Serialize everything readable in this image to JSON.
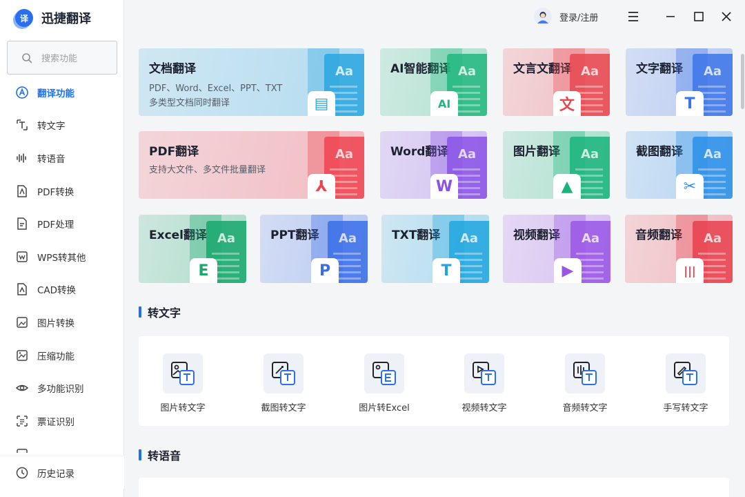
{
  "app": {
    "name": "迅捷翻译",
    "logo_glyph": "译"
  },
  "search": {
    "placeholder": "搜索功能"
  },
  "sidebar": {
    "items": [
      {
        "label": "翻译功能",
        "icon": "translate-icon",
        "active": true
      },
      {
        "label": "转文字",
        "icon": "text-convert-icon"
      },
      {
        "label": "转语音",
        "icon": "voice-icon"
      },
      {
        "label": "PDF转换",
        "icon": "pdf-convert-icon"
      },
      {
        "label": "PDF处理",
        "icon": "pdf-process-icon"
      },
      {
        "label": "WPS转其他",
        "icon": "wps-icon"
      },
      {
        "label": "CAD转换",
        "icon": "cad-icon"
      },
      {
        "label": "图片转换",
        "icon": "image-convert-icon"
      },
      {
        "label": "压缩功能",
        "icon": "compress-icon"
      },
      {
        "label": "多功能识别",
        "icon": "eye-icon"
      },
      {
        "label": "票证识别",
        "icon": "ticket-icon"
      }
    ],
    "history": "历史记录"
  },
  "header": {
    "login": "登录/注册"
  },
  "cards": [
    {
      "title": "文档翻译",
      "desc": [
        "PDF、Word、Excel、PPT、TXT",
        "多类型文档同时翻译"
      ],
      "badge": "▤",
      "color": "#2aa7e0"
    },
    {
      "title": "AI智能翻译",
      "badge": "AI",
      "color": "#21b77f"
    },
    {
      "title": "文言文翻译",
      "badge": "文",
      "color": "#e8474f"
    },
    {
      "title": "文字翻译",
      "badge": "T",
      "color": "#3c74e8"
    },
    {
      "title": "PDF翻译",
      "desc": [
        "支持大文件、多文件批量翻译"
      ],
      "badge": "⅄",
      "color": "#ee4450"
    },
    {
      "title": "Word翻译",
      "badge": "W",
      "color": "#8a52e6"
    },
    {
      "title": "图片翻译",
      "badge": "▲",
      "color": "#19b47b"
    },
    {
      "title": "截图翻译",
      "badge": "✂",
      "color": "#2a8ee8"
    },
    {
      "title": "Excel翻译",
      "badge": "E",
      "color": "#18a86c"
    },
    {
      "title": "PPT翻译",
      "badge": "P",
      "color": "#3a6ee8"
    },
    {
      "title": "TXT翻译",
      "badge": "T",
      "color": "#20a6df"
    },
    {
      "title": "视频翻译",
      "badge": "▶",
      "color": "#9a55e6"
    },
    {
      "title": "音频翻译",
      "badge": "|||",
      "color": "#e8404c"
    }
  ],
  "sections": [
    {
      "title": "转文字",
      "tools": [
        {
          "label": "图片转文字",
          "icon": "image-to-text-icon"
        },
        {
          "label": "截图转文字",
          "icon": "screenshot-to-text-icon"
        },
        {
          "label": "图片转Excel",
          "icon": "image-to-excel-icon"
        },
        {
          "label": "视频转文字",
          "icon": "video-to-text-icon"
        },
        {
          "label": "音频转文字",
          "icon": "audio-to-text-icon"
        },
        {
          "label": "手写转文字",
          "icon": "handwriting-to-text-icon"
        }
      ]
    },
    {
      "title": "转语音"
    }
  ]
}
